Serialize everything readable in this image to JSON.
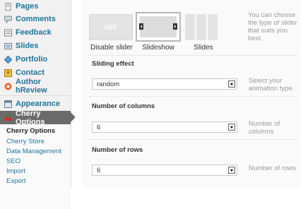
{
  "sidebar": {
    "items": [
      {
        "label": "Pages",
        "icon": "pages-icon"
      },
      {
        "label": "Comments",
        "icon": "comments-icon"
      },
      {
        "label": "Feedback",
        "icon": "feedback-icon"
      },
      {
        "label": "Slides",
        "icon": "slides-icon"
      },
      {
        "label": "Portfolio",
        "icon": "portfolio-icon"
      },
      {
        "label": "Contact",
        "icon": "contact-icon"
      },
      {
        "label": "Author hReview",
        "icon": "author-hreview-icon"
      },
      {
        "label": "Appearance",
        "icon": "appearance-icon"
      },
      {
        "label": "Cherry Options",
        "icon": "cherry-icon"
      }
    ],
    "submenu": [
      "Cherry Options",
      "Cherry Store",
      "Data Management",
      "SEO",
      "Import",
      "Export"
    ]
  },
  "slider_type": {
    "options": [
      {
        "caption": "Disable slider",
        "thumb_text": "OFF"
      },
      {
        "caption": "Slideshow"
      },
      {
        "caption": "Slides"
      }
    ],
    "selected": "Slideshow",
    "hint": "You can choose the type of slider that suits you best."
  },
  "fields": [
    {
      "label": "Sliding effect",
      "value": "random",
      "hint": "Select your animation type."
    },
    {
      "label": "Number of columns",
      "value": "6",
      "hint": "Number of columns"
    },
    {
      "label": "Number of rows",
      "value": "6",
      "hint": "Number of rows"
    }
  ],
  "colors": {
    "link": "#21759b",
    "active_bg": "#6b6b6b"
  }
}
